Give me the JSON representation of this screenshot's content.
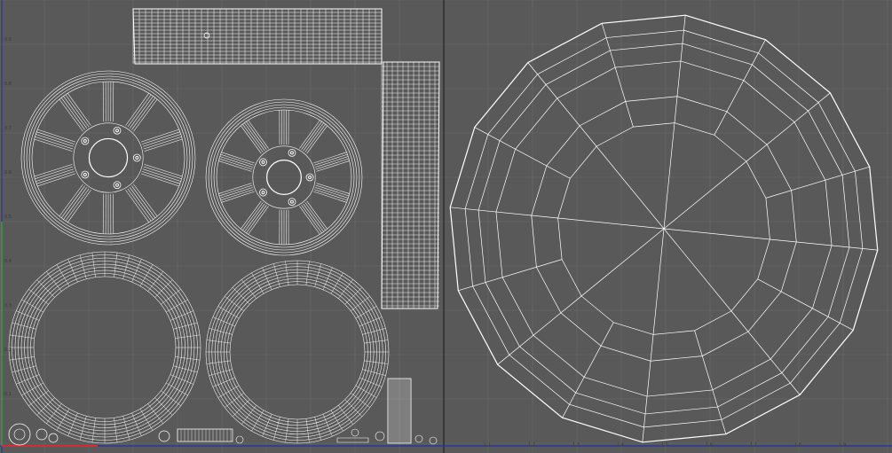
{
  "viewport": {
    "background": "#595959",
    "grid_color": "#6a6a6a",
    "wire_color": "#ffffff",
    "u_axis_color": "#2233aa",
    "v_axis_color": "#33aa44",
    "origin_color": "#ff2222"
  },
  "axis_labels": {
    "left": [
      "0.9",
      "0.8",
      "0.7",
      "0.6",
      "0.5",
      "0.4",
      "0.3",
      "0.2",
      "0.1"
    ],
    "bottom": [
      "1.1",
      "1.2",
      "1.3",
      "1.4",
      "1.5",
      "1.6",
      "1.7",
      "1.8",
      "1.9"
    ]
  },
  "icons": {
    "wheel_rim_large": "rim-wireframe-icon",
    "wheel_rim_small": "rim-wireframe-icon",
    "tire_ring": "tire-ring-wireframe-icon",
    "tread_strip": "tread-strip-icon",
    "disc": "disc-wireframe-icon"
  }
}
